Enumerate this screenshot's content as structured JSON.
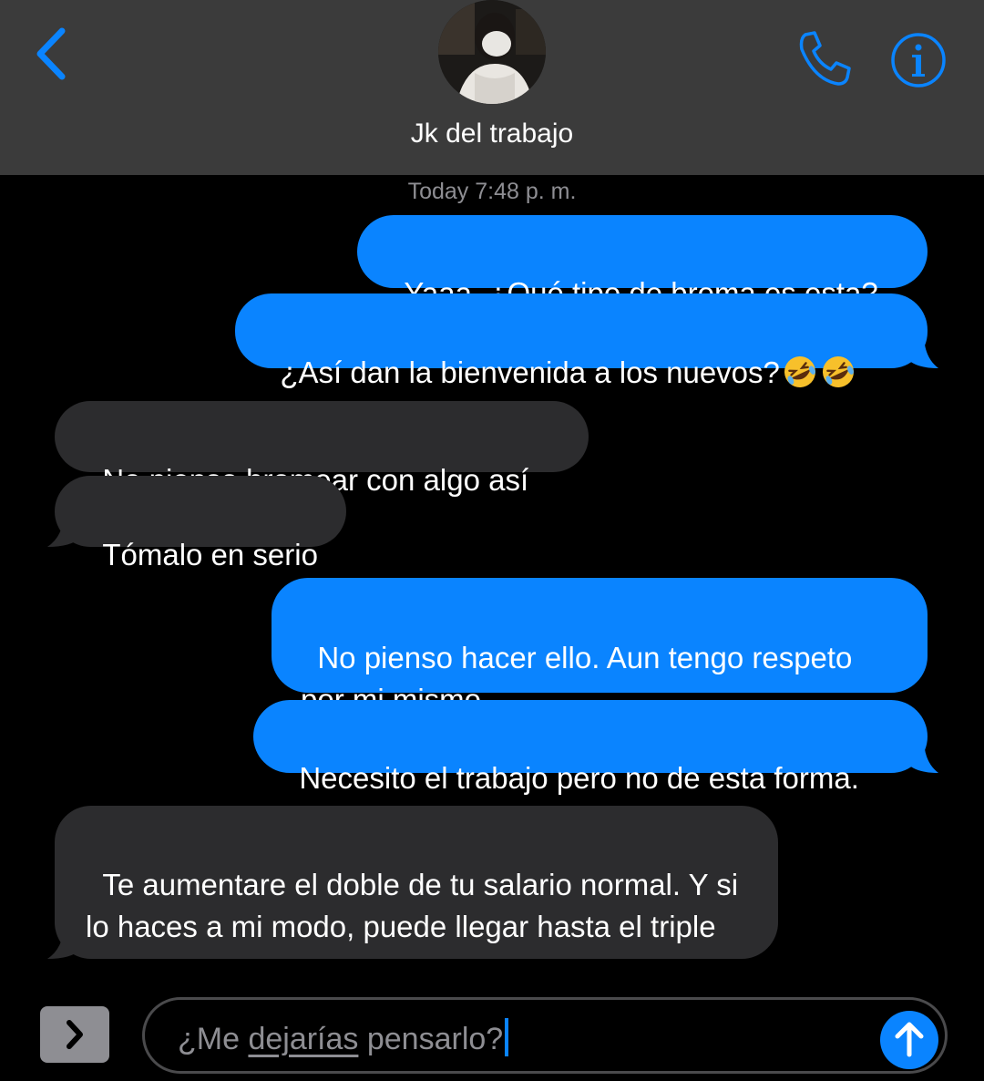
{
  "header": {
    "back_icon": "chevron-left-icon",
    "contact_name": "Jk del trabajo",
    "call_icon": "phone-icon",
    "info_icon": "info-icon",
    "background_color": "#3b3b3b",
    "accent_color": "#0a84ff"
  },
  "thread": {
    "timestamp": "Today 7:48 p. m.",
    "messages": [
      {
        "direction": "sent",
        "text": "Yaaa. ¿Qué tipo de broma es esta?"
      },
      {
        "direction": "sent",
        "text": "¿Así dan la bienvenida a los nuevos?",
        "emoji": [
          "rolling-on-floor-laughing",
          "rolling-on-floor-laughing"
        ]
      },
      {
        "direction": "received",
        "text": "No pienso bromear con algo así"
      },
      {
        "direction": "received",
        "text": "Tómalo en serio"
      },
      {
        "direction": "sent",
        "text": "No pienso hacer ello. Aun tengo respeto por mi mismo"
      },
      {
        "direction": "sent",
        "text": "Necesito el trabajo pero no de esta forma."
      },
      {
        "direction": "received",
        "text": "Te aumentare el doble de tu salario normal. Y si lo haces a mi modo, puede llegar hasta el triple"
      }
    ],
    "sent_color": "#0a84ff",
    "received_color": "#2c2c2e"
  },
  "composer": {
    "apps_icon": "chevron-right-icon",
    "text_before": "¿Me ",
    "text_underlined": "dejarías",
    "text_after": " pensarlo?",
    "send_icon": "arrow-up-icon"
  }
}
